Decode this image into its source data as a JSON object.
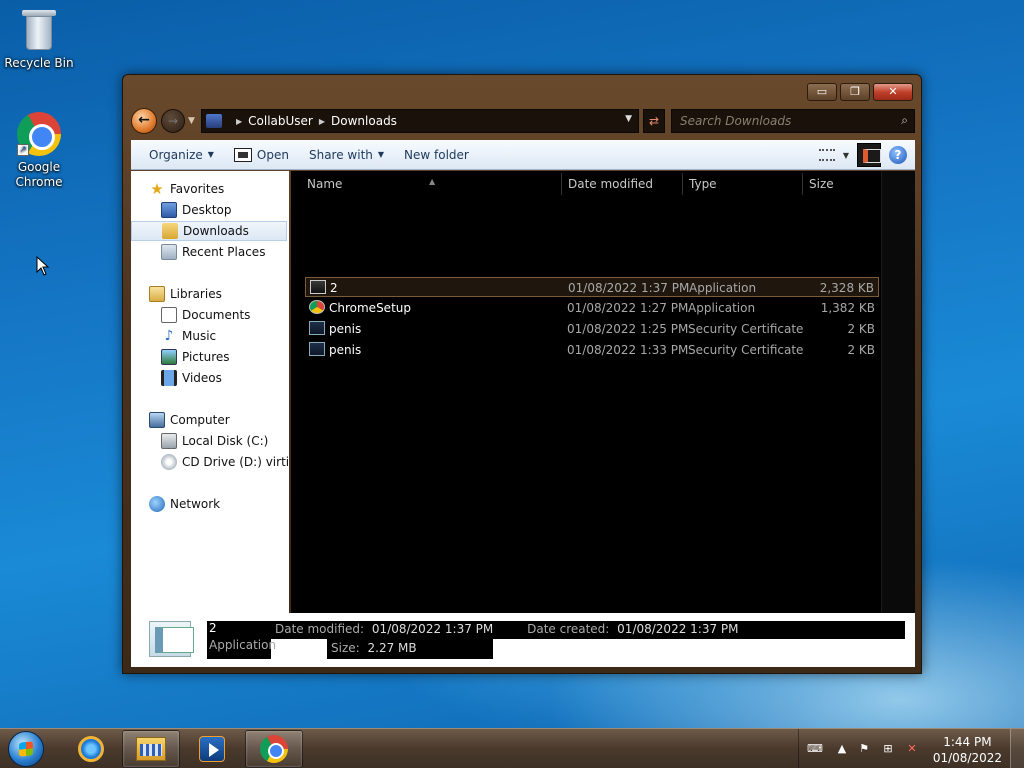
{
  "desktop": {
    "icons": [
      {
        "label": "Recycle Bin",
        "icon": "recycle-bin-icon"
      },
      {
        "label": "Google Chrome",
        "icon": "chrome-icon"
      }
    ]
  },
  "window": {
    "controls": {
      "minimize": "▭",
      "maximize": "❐",
      "close": "✕"
    },
    "address": {
      "crumbs": [
        "CollabUser",
        "Downloads"
      ]
    },
    "search_placeholder": "Search Downloads",
    "toolbar": {
      "organize": "Organize",
      "open": "Open",
      "share_with": "Share with",
      "new_folder": "New folder"
    },
    "nav": {
      "favorites": "Favorites",
      "desktop": "Desktop",
      "downloads": "Downloads",
      "recent_places": "Recent Places",
      "libraries": "Libraries",
      "documents": "Documents",
      "music": "Music",
      "pictures": "Pictures",
      "videos": "Videos",
      "computer": "Computer",
      "local_disk": "Local Disk (C:)",
      "cd_drive": "CD Drive (D:) virtio-v",
      "network": "Network"
    },
    "columns": {
      "name": "Name",
      "date": "Date modified",
      "type": "Type",
      "size": "Size"
    },
    "files": [
      {
        "name": "2",
        "date": "01/08/2022 1:37 PM",
        "type": "Application",
        "size": "2,328 KB",
        "icon": "application-icon",
        "selected": true
      },
      {
        "name": "ChromeSetup",
        "date": "01/08/2022 1:27 PM",
        "type": "Application",
        "size": "1,382 KB",
        "icon": "chrome-setup-icon",
        "selected": false
      },
      {
        "name": "penis",
        "date": "01/08/2022 1:25 PM",
        "type": "Security Certificate",
        "size": "2 KB",
        "icon": "certificate-icon",
        "selected": false
      },
      {
        "name": "penis",
        "date": "01/08/2022 1:33 PM",
        "type": "Security Certificate",
        "size": "2 KB",
        "icon": "certificate-icon",
        "selected": false
      }
    ],
    "details": {
      "name": "2",
      "type": "Application",
      "date_modified_label": "Date modified:",
      "date_modified": "01/08/2022 1:37 PM",
      "date_created_label": "Date created:",
      "date_created": "01/08/2022 1:37 PM",
      "size_label": "Size:",
      "size": "2.27 MB"
    }
  },
  "taskbar": {
    "clock_time": "1:44 PM",
    "clock_date": "01/08/2022"
  }
}
